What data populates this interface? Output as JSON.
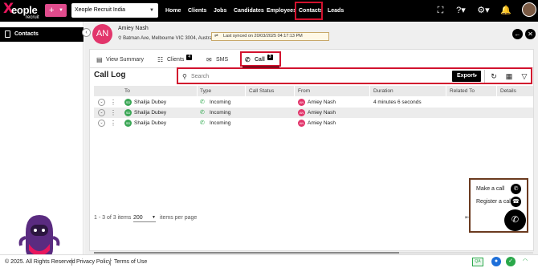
{
  "app": {
    "logo_text": "eople",
    "logo_sub": "recruit",
    "company_selector": "Xeople Recruit India",
    "nav": [
      {
        "label": "Home"
      },
      {
        "label": "Clients"
      },
      {
        "label": "Jobs"
      },
      {
        "label": "Candidates"
      },
      {
        "label": "Employees"
      },
      {
        "label": "Contacts",
        "active": true
      },
      {
        "label": "Leads"
      }
    ],
    "icons": [
      "plus-icon",
      "fullscreen-icon",
      "help-icon",
      "settings-icon",
      "bell-icon"
    ]
  },
  "sidebar": {
    "title": "Contacts"
  },
  "contact": {
    "initials": "AN",
    "name": "Amiey Nash",
    "address": "Batman Ave, Melbourne VIC 3004, Austra...",
    "sync_text": "Last synced on 20/03/2025 04:17:13 PM"
  },
  "tabs": [
    {
      "label": "View Summary"
    },
    {
      "label": "Clients",
      "badge": "4"
    },
    {
      "label": "SMS"
    },
    {
      "label": "Call",
      "badge": "3",
      "active": true
    }
  ],
  "call_log": {
    "title": "Call Log",
    "search_placeholder": "Search",
    "export_label": "Export",
    "columns": [
      "To",
      "Type",
      "Call Status",
      "From",
      "Duration",
      "Related To",
      "Details"
    ],
    "rows": [
      {
        "to_initials": "SD",
        "to": "Shailja Dubey",
        "type": "Incoming",
        "status": "",
        "from_initials": "AN",
        "from": "Amiey Nash",
        "duration": "4 minutes 6 seconds",
        "related": "",
        "details": ""
      },
      {
        "to_initials": "SD",
        "to": "Shailja Dubey",
        "type": "Incoming",
        "status": "",
        "from_initials": "AN",
        "from": "Amiey Nash",
        "duration": "",
        "related": "",
        "details": ""
      },
      {
        "to_initials": "SD",
        "to": "Shailja Dubey",
        "type": "Incoming",
        "status": "",
        "from_initials": "AN",
        "from": "Amiey Nash",
        "duration": "",
        "related": "",
        "details": ""
      }
    ]
  },
  "pagination": {
    "range_text": "1 - 3 of 3 items",
    "page_size": "200",
    "page_size_suffix": "items per page",
    "current_page": "1"
  },
  "call_widget": {
    "make_call": "Make a call",
    "register_call": "Register a call"
  },
  "footer": {
    "copyright": "© 2025. All Rights Reserved",
    "privacy": "Privacy Policy",
    "terms": "Terms of Use",
    "qa_badge": "QA"
  },
  "colors": {
    "accent_pink": "#e04b8c",
    "avatar_pink": "#e2356b",
    "avatar_green": "#3aa655",
    "highlight_red": "#d2122e",
    "widget_border": "#6b3a1f"
  }
}
